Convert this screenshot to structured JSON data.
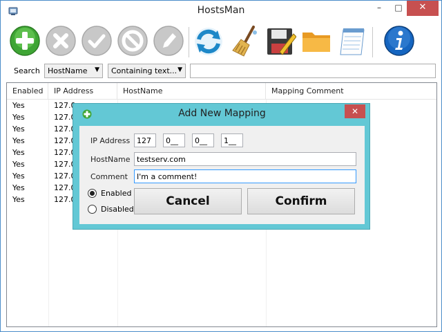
{
  "window": {
    "title": "HostsMan",
    "controls": {
      "minimize": "–",
      "maximize": "□",
      "close": "✕"
    }
  },
  "toolbar": {
    "buttons": [
      {
        "name": "add",
        "icon": "plus-circle-icon",
        "color": "#4caf2a",
        "enabled": true
      },
      {
        "name": "remove",
        "icon": "x-circle-icon",
        "color": "#b5b5b5",
        "enabled": false
      },
      {
        "name": "enable",
        "icon": "check-circle-icon",
        "color": "#b5b5b5",
        "enabled": false
      },
      {
        "name": "disable",
        "icon": "no-circle-icon",
        "color": "#b5b5b5",
        "enabled": false
      },
      {
        "name": "edit",
        "icon": "pencil-circle-icon",
        "color": "#b5b5b5",
        "enabled": false
      },
      {
        "name": "refresh",
        "icon": "refresh-arrows-icon",
        "color": "#1e88c8",
        "enabled": true
      },
      {
        "name": "clean",
        "icon": "broom-icon",
        "color": "#d9a441",
        "enabled": true
      },
      {
        "name": "save",
        "icon": "floppy-pencil-icon",
        "color": "#333333",
        "enabled": true
      },
      {
        "name": "open-folder",
        "icon": "folder-icon",
        "color": "#f0a830",
        "enabled": true
      },
      {
        "name": "notepad",
        "icon": "notepad-icon",
        "color": "#5ba3d9",
        "enabled": true
      },
      {
        "name": "about",
        "icon": "info-icon",
        "color": "#1565c0",
        "enabled": true
      }
    ]
  },
  "search": {
    "label": "Search",
    "field_select": "HostName",
    "mode_select": "Containing text...",
    "query": ""
  },
  "table": {
    "headers": [
      "Enabled",
      "IP Address",
      "HostName",
      "Mapping Comment"
    ],
    "rows": [
      {
        "enabled": "Yes",
        "ip": "127.0"
      },
      {
        "enabled": "Yes",
        "ip": "127.0"
      },
      {
        "enabled": "Yes",
        "ip": "127.0"
      },
      {
        "enabled": "Yes",
        "ip": "127.0"
      },
      {
        "enabled": "Yes",
        "ip": "127.0"
      },
      {
        "enabled": "Yes",
        "ip": "127.0"
      },
      {
        "enabled": "Yes",
        "ip": "127.0"
      },
      {
        "enabled": "Yes",
        "ip": "127.0"
      },
      {
        "enabled": "Yes",
        "ip": "127.0"
      }
    ]
  },
  "dialog": {
    "title": "Add New Mapping",
    "close": "✕",
    "ip_label": "IP Address",
    "ip_octets": [
      "127",
      "0__",
      "0__",
      "1__"
    ],
    "hostname_label": "HostName",
    "hostname_value": "testserv.com",
    "comment_label": "Comment",
    "comment_value": "I'm a comment!",
    "enabled_label": "Enabled",
    "disabled_label": "Disabled",
    "selected_state": "Enabled",
    "cancel_label": "Cancel",
    "confirm_label": "Confirm"
  }
}
